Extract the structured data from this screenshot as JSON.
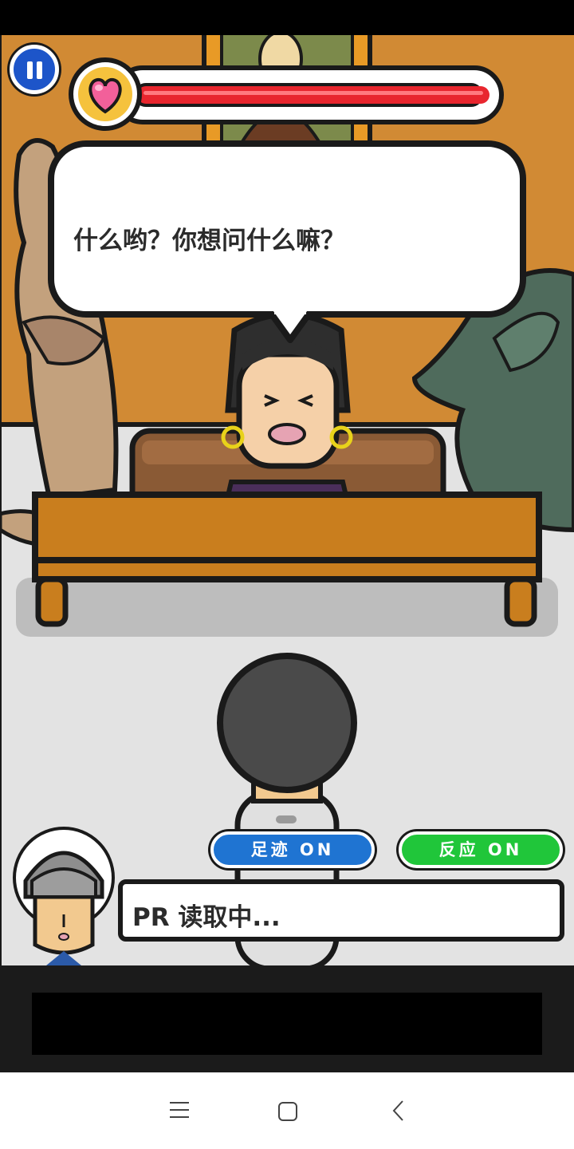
{
  "speech": {
    "text": "什么哟？你想问什么嘛？"
  },
  "health": {
    "fraction": 1.0
  },
  "toggles": {
    "footprints": {
      "label": "足迹 ON",
      "color": "#1f74d2"
    },
    "reaction": {
      "label": "反应 ON",
      "color": "#20c63a"
    }
  },
  "status": {
    "text": "PR 读取中..."
  },
  "colors": {
    "wall": "#d18a34",
    "floor": "#e3e3e3",
    "desk": "#c97e1e"
  },
  "nav": {
    "icons": [
      "menu-icon",
      "home-square-icon",
      "back-icon"
    ]
  }
}
